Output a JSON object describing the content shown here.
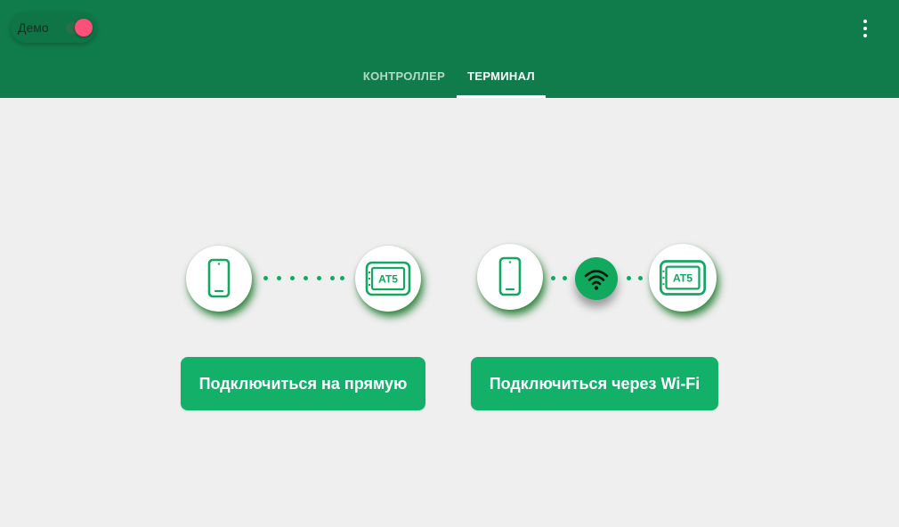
{
  "toolbar": {
    "demo_label": "Демо",
    "demo_enabled": true,
    "menu_icon": "more-vert-icon"
  },
  "tabs": [
    {
      "label": "КОНТРОЛЛЕР",
      "selected": false
    },
    {
      "label": "ТЕРМИНАЛ",
      "selected": true
    }
  ],
  "options": [
    {
      "button_label": "Подключиться на прямую",
      "icons": [
        "smartphone-icon",
        "terminal-device-icon"
      ],
      "device_label": "AT5"
    },
    {
      "button_label": "Подключиться через Wi-Fi",
      "icons": [
        "smartphone-icon",
        "wifi-icon",
        "terminal-device-icon"
      ],
      "device_label": "AT5"
    }
  ],
  "colors": {
    "appbar": "#107c4c",
    "accent": "#13b06a",
    "switch_thumb": "#ff4f7b",
    "background": "#efefef"
  }
}
